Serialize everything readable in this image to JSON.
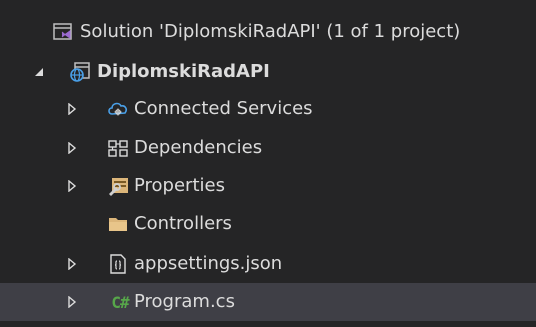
{
  "solution": {
    "label": "Solution 'DiplomskiRadAPI' (1 of 1 project)",
    "icon": "solution-icon"
  },
  "project": {
    "label": "DiplomskiRadAPI",
    "icon": "web-project-icon",
    "expanded": true
  },
  "items": [
    {
      "label": "Connected Services",
      "icon": "cloud-icon",
      "expandable": true
    },
    {
      "label": "Dependencies",
      "icon": "dependencies-icon",
      "expandable": true
    },
    {
      "label": "Properties",
      "icon": "wrench-icon",
      "expandable": true
    },
    {
      "label": "Controllers",
      "icon": "folder-icon",
      "expandable": false
    },
    {
      "label": "appsettings.json",
      "icon": "json-file-icon",
      "expandable": true
    },
    {
      "label": "Program.cs",
      "icon": "csharp-file-icon",
      "icon_text": "C#",
      "expandable": true,
      "selected": true
    }
  ],
  "colors": {
    "background": "#252526",
    "selected_row": "#3f3f46",
    "text": "#dcdcdc",
    "accent_blue": "#4aa0e8",
    "folder": "#dcb67a",
    "csharp": "#57a64a",
    "solution_purple": "#9b6bd1"
  }
}
